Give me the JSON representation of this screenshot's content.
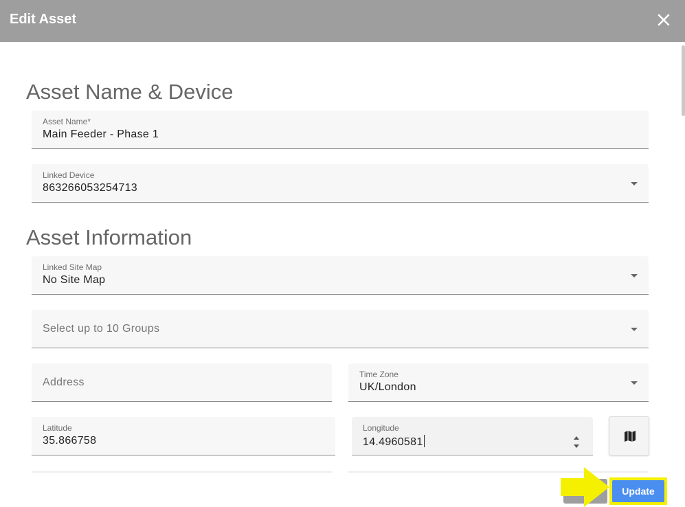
{
  "dialog": {
    "title": "Edit Asset",
    "close_icon": "close-icon"
  },
  "sections": {
    "name_device": "Asset Name & Device",
    "information": "Asset Information"
  },
  "fields": {
    "asset_name": {
      "label": "Asset Name*",
      "value": "Main Feeder - Phase 1"
    },
    "linked_device": {
      "label": "Linked Device",
      "value": "863266053254713"
    },
    "linked_site_map": {
      "label": "Linked Site Map",
      "value": "No Site Map"
    },
    "groups": {
      "placeholder": "Select up to 10 Groups"
    },
    "address": {
      "placeholder": "Address"
    },
    "time_zone": {
      "label": "Time Zone",
      "value": "UK/London"
    },
    "latitude": {
      "label": "Latitude",
      "value": "35.866758"
    },
    "longitude": {
      "label": "Longitude",
      "value": "14.4960581"
    }
  },
  "buttons": {
    "update": "Update",
    "map_icon": "map-icon"
  },
  "colors": {
    "header": "#9e9e9e",
    "update_button": "#4a8ef0",
    "highlight": "#f5f000"
  }
}
